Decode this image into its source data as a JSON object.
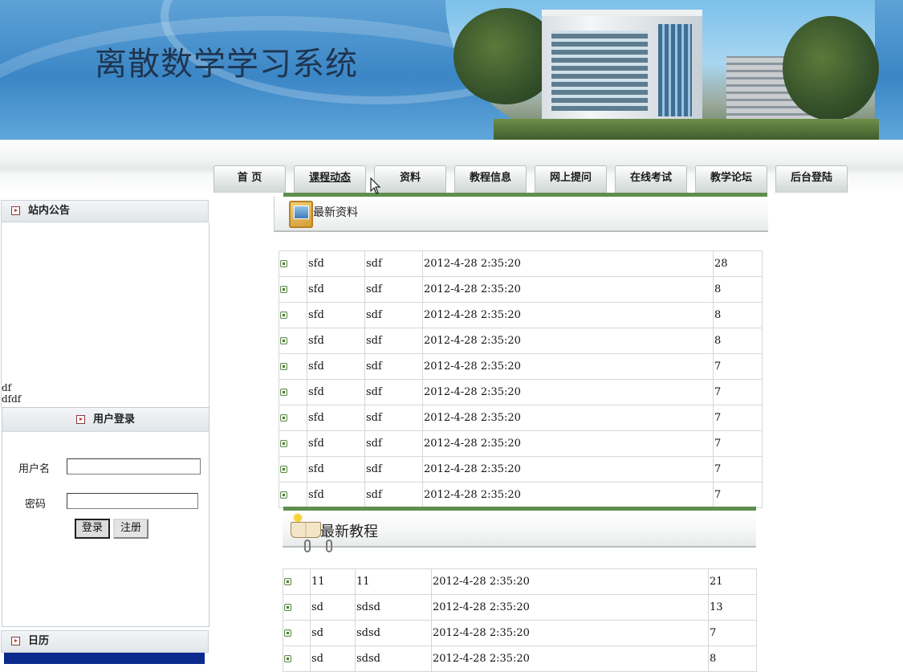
{
  "banner": {
    "title": "离散数学学习系统"
  },
  "nav": {
    "tabs": [
      {
        "label": "首  页"
      },
      {
        "label": "课程动态",
        "active": true
      },
      {
        "label": "资料"
      },
      {
        "label": "教程信息"
      },
      {
        "label": "网上提问"
      },
      {
        "label": "在线考试"
      },
      {
        "label": "教学论坛"
      },
      {
        "label": "后台登陆"
      }
    ]
  },
  "notice": {
    "title": "站内公告",
    "lines": [
      "df",
      "dfdf"
    ]
  },
  "login": {
    "title": "用户登录",
    "username_label": "用户名",
    "password_label": "密码",
    "username_value": "",
    "password_value": "",
    "login_button": "登录",
    "register_button": "注册"
  },
  "calendar": {
    "title": "日历"
  },
  "latest_materials": {
    "title": "最新资料",
    "rows": [
      {
        "name": "sfd",
        "author": "sdf",
        "time": "2012-4-28 2:35:20",
        "count": "28"
      },
      {
        "name": "sfd",
        "author": "sdf",
        "time": "2012-4-28 2:35:20",
        "count": "8"
      },
      {
        "name": "sfd",
        "author": "sdf",
        "time": "2012-4-28 2:35:20",
        "count": "8"
      },
      {
        "name": "sfd",
        "author": "sdf",
        "time": "2012-4-28 2:35:20",
        "count": "8"
      },
      {
        "name": "sfd",
        "author": "sdf",
        "time": "2012-4-28 2:35:20",
        "count": "7"
      },
      {
        "name": "sfd",
        "author": "sdf",
        "time": "2012-4-28 2:35:20",
        "count": "7"
      },
      {
        "name": "sfd",
        "author": "sdf",
        "time": "2012-4-28 2:35:20",
        "count": "7"
      },
      {
        "name": "sfd",
        "author": "sdf",
        "time": "2012-4-28 2:35:20",
        "count": "7"
      },
      {
        "name": "sfd",
        "author": "sdf",
        "time": "2012-4-28 2:35:20",
        "count": "7"
      },
      {
        "name": "sfd",
        "author": "sdf",
        "time": "2012-4-28 2:35:20",
        "count": "7"
      }
    ]
  },
  "latest_tutorials": {
    "title": "最新教程",
    "rows": [
      {
        "name": "11",
        "author": "11",
        "time": "2012-4-28 2:35:20",
        "count": "21"
      },
      {
        "name": "sd",
        "author": "sdsd",
        "time": "2012-4-28 2:35:20",
        "count": "13"
      },
      {
        "name": "sd",
        "author": "sdsd",
        "time": "2012-4-28 2:35:20",
        "count": "7"
      },
      {
        "name": "sd",
        "author": "sdsd",
        "time": "2012-4-28 2:35:20",
        "count": "8"
      }
    ]
  },
  "colors": {
    "accent_green": "#5f8e4e",
    "banner_blue": "#3b86c6",
    "calendar_blue": "#0a2a8c"
  }
}
